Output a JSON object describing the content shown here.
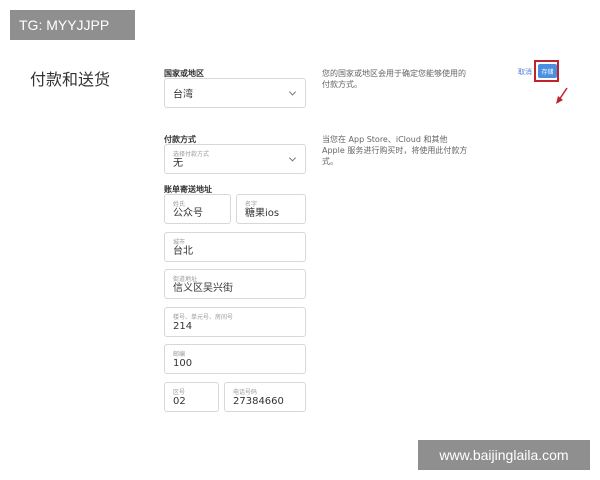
{
  "watermarks": {
    "top": "TG: MYYJJPP",
    "bottom": "www.baijinglaila.com"
  },
  "section": {
    "title": "付款和送货"
  },
  "region": {
    "label": "国家或地区",
    "value": "台湾",
    "description": "您的国家或地区会用于确定您能够使用的付款方式。"
  },
  "actions": {
    "cancel_label": "取消",
    "save_label": "存储"
  },
  "payment": {
    "label": "付款方式",
    "select_sublabel": "选择付款方式",
    "select_value": "无",
    "description": "当您在 App Store、iCloud 和其他 Apple 服务进行购买时，将使用此付款方式。"
  },
  "billing": {
    "label": "账单寄送地址",
    "last_name": {
      "label": "姓氏",
      "value": "公众号"
    },
    "first_name": {
      "label": "名字",
      "value": "糖果ios"
    },
    "city": {
      "label": "城市",
      "value": "台北"
    },
    "street": {
      "label": "街道地址",
      "value": "信义区吴兴街"
    },
    "unit": {
      "label": "楼号、单元号、房间号",
      "value": "214"
    },
    "postal": {
      "label": "邮编",
      "value": "100"
    },
    "area_code": {
      "label": "区号",
      "value": "02"
    },
    "phone": {
      "label": "电话号码",
      "value": "27384660"
    }
  },
  "colors": {
    "accent": "#4a8fe0",
    "highlight": "#c0232b",
    "watermark_bg": "#8f8f8f"
  }
}
